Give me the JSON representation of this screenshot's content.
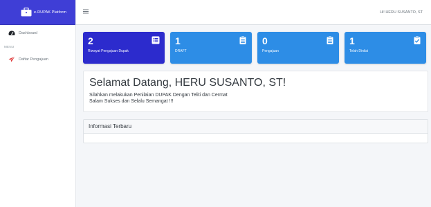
{
  "brand": {
    "title": "e-DUPAK Platform"
  },
  "sidebar": {
    "dashboard_label": "Dashboard",
    "menu_header": "MENU",
    "items": [
      {
        "label": "Daftar Pengajuan"
      }
    ]
  },
  "topbar": {
    "greeting": "Hi! HERU SUSANTO, ST"
  },
  "cards": [
    {
      "count": "2",
      "label": "Riwayat Pengajuan Dupak",
      "color": "#2c2bcd",
      "icon": "list-icon"
    },
    {
      "count": "1",
      "label": "DRAFT",
      "color": "#2d8de6",
      "icon": "clipboard-list-icon"
    },
    {
      "count": "0",
      "label": "Pengajuan",
      "color": "#2d8de6",
      "icon": "clipboard-list-icon"
    },
    {
      "count": "1",
      "label": "Telah Dinilai",
      "color": "#2d8de6",
      "icon": "clipboard-check-icon"
    }
  ],
  "welcome": {
    "title": "Selamat Datang, HERU SUSANTO, ST!",
    "line1": "Silahkan melakukan Penilaian DUPAK Dengan Teliti dan Cermat",
    "line2": "Salam Sukses dan Selalu Semangat !!!"
  },
  "info": {
    "title": "Informasi Terbaru"
  }
}
